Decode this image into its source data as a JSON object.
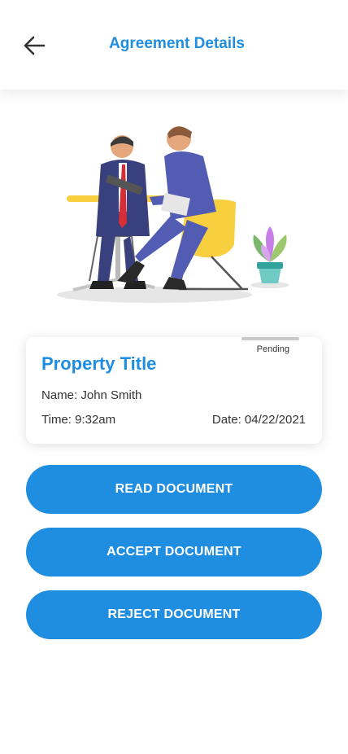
{
  "header": {
    "title": "Agreement Details",
    "back_icon": "arrow-left-icon"
  },
  "card": {
    "status": "Pending",
    "title": "Property Title",
    "name": "Name: John Smith",
    "time": "Time: 9:32am",
    "date": "Date: 04/22/2021"
  },
  "actions": {
    "read": "READ DOCUMENT",
    "accept": "ACCEPT DOCUMENT",
    "reject": "REJECT DOCUMENT"
  },
  "colors": {
    "accent": "#1f8de0"
  }
}
